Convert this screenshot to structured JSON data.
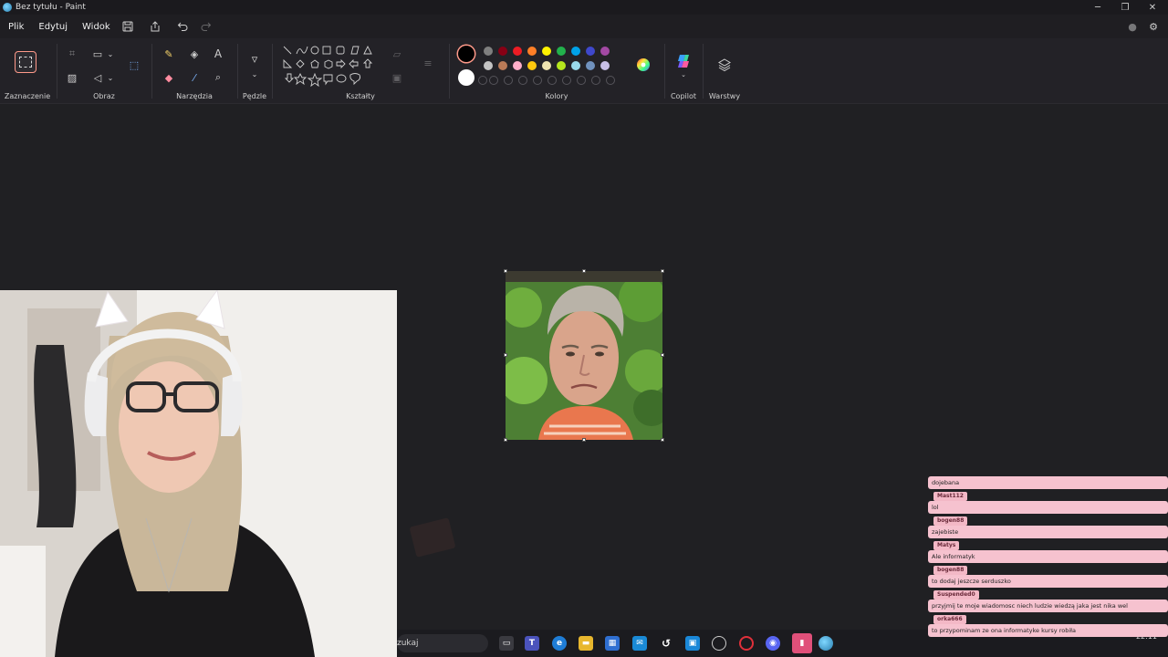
{
  "window": {
    "title": "Bez tytułu - Paint",
    "minimize_glyph": "─",
    "maximize_glyph": "❐",
    "close_glyph": "✕"
  },
  "menu": {
    "items": [
      "Plik",
      "Edytuj",
      "Widok"
    ]
  },
  "ribbon": {
    "groups": {
      "selection": "Zaznaczenie",
      "image": "Obraz",
      "tools": "Narzędzia",
      "brushes": "Pędzle",
      "shapes": "Kształty",
      "colors": "Kolory",
      "copilot": "Copilot",
      "layers": "Warstwy"
    },
    "icons": {
      "save": "save-icon",
      "share": "share-icon",
      "undo": "undo-icon",
      "redo": "redo-icon",
      "settings": "gear-icon"
    }
  },
  "colors": {
    "primary": "#000000",
    "secondary": "#ffffff",
    "palette_row1": [
      "#000000",
      "#7f7f7f",
      "#880015",
      "#ed1c24",
      "#ff7f27",
      "#fff200",
      "#22b14c",
      "#00a2e8",
      "#3f48cc",
      "#a349a4"
    ],
    "palette_row2": [
      "#ffffff",
      "#c3c3c3",
      "#b97a57",
      "#ffaec9",
      "#ffc90e",
      "#efe4b0",
      "#b5e61d",
      "#99d9ea",
      "#7092be",
      "#c8bfe7"
    ],
    "accent": "#ff9a8a",
    "chat_bg": "#f6c2cf"
  },
  "taskbar": {
    "search_text": "zukaj",
    "clock_time": "22:11"
  },
  "chat": {
    "messages": [
      {
        "name": "",
        "text": "dojebana"
      },
      {
        "name": "Mast112",
        "text": "lol"
      },
      {
        "name": "bogen88",
        "text": "zajebiste"
      },
      {
        "name": "Matys",
        "text": "Ale informatyk"
      },
      {
        "name": "bogen88",
        "text": "to dodaj jeszcze serduszko"
      },
      {
        "name": "Suspended0",
        "text": "przyjmij te moje wiadomosc niech ludzie wiedzą jaka jest nika wel"
      },
      {
        "name": "orka666",
        "text": "to przypominam ze ona informatyke kursy robiła"
      }
    ]
  }
}
